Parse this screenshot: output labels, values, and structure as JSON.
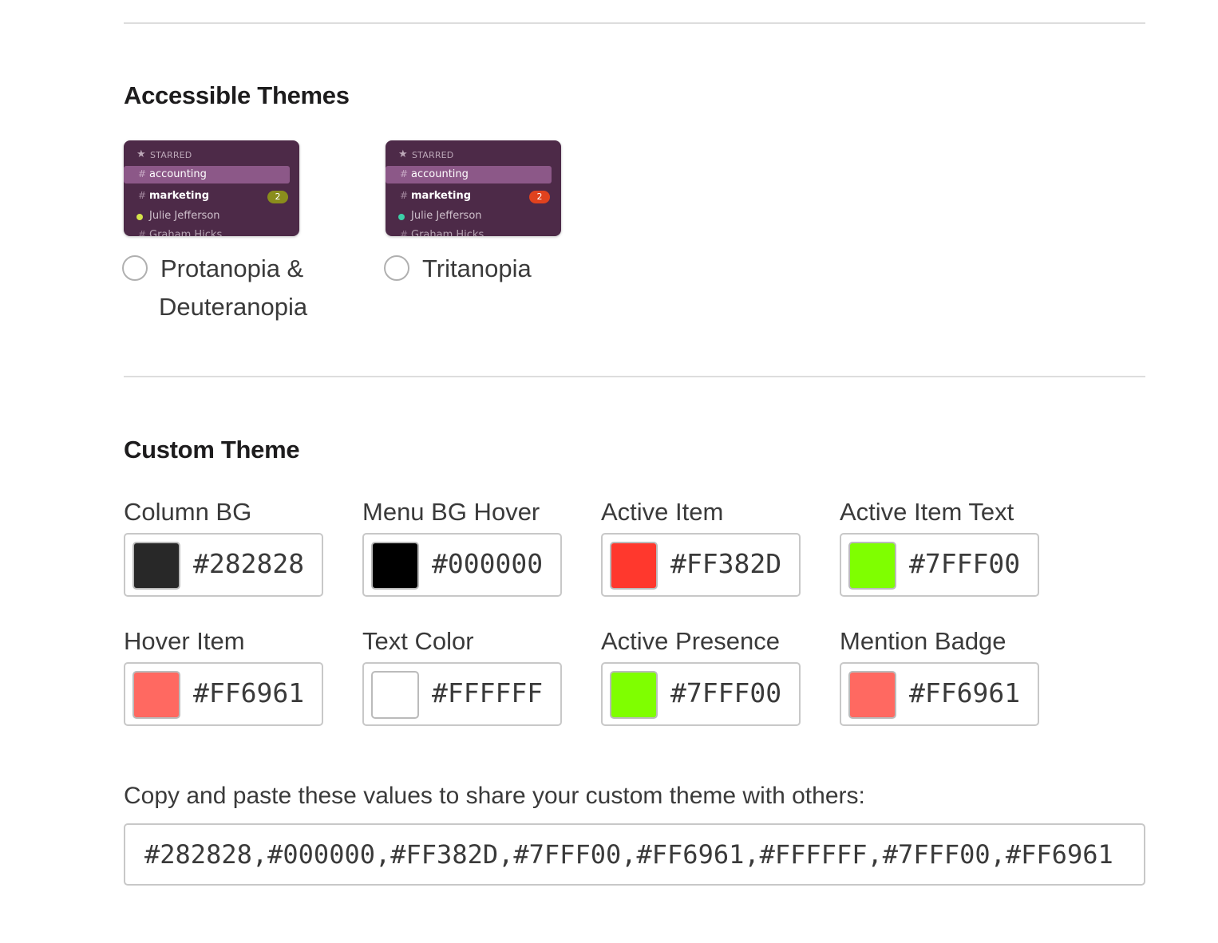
{
  "accessible_themes": {
    "title": "Accessible Themes",
    "preview": {
      "starred_label": "STARRED",
      "active_channel": "accounting",
      "unread_channel": "marketing",
      "badge_count": "2",
      "user_name": "Julie Jefferson",
      "cut_item": "Graham Hicks"
    },
    "options": [
      {
        "label_line1": "Protanopia &",
        "label_line2": "Deuteranopia",
        "badge_color": "#8a8d1c",
        "presence_color": "#d4e34a",
        "selected": false
      },
      {
        "label_line1": "Tritanopia",
        "badge_color": "#e0421e",
        "presence_color": "#3cd0a8",
        "selected": false
      }
    ]
  },
  "custom_theme": {
    "title": "Custom Theme",
    "fields": [
      {
        "label": "Column BG",
        "value": "#282828",
        "color": "#282828"
      },
      {
        "label": "Menu BG Hover",
        "value": "#000000",
        "color": "#000000"
      },
      {
        "label": "Active Item",
        "value": "#FF382D",
        "color": "#FF382D"
      },
      {
        "label": "Active Item Text",
        "value": "#7FFF00",
        "color": "#7FFF00"
      },
      {
        "label": "Hover Item",
        "value": "#FF6961",
        "color": "#FF6961"
      },
      {
        "label": "Text Color",
        "value": "#FFFFFF",
        "color": "#FFFFFF"
      },
      {
        "label": "Active Presence",
        "value": "#7FFF00",
        "color": "#7FFF00"
      },
      {
        "label": "Mention Badge",
        "value": "#FF6961",
        "color": "#FF6961"
      }
    ],
    "share_label": "Copy and paste these values to share your custom theme with others:",
    "share_value": "#282828,#000000,#FF382D,#7FFF00,#FF6961,#FFFFFF,#7FFF00,#FF6961"
  }
}
